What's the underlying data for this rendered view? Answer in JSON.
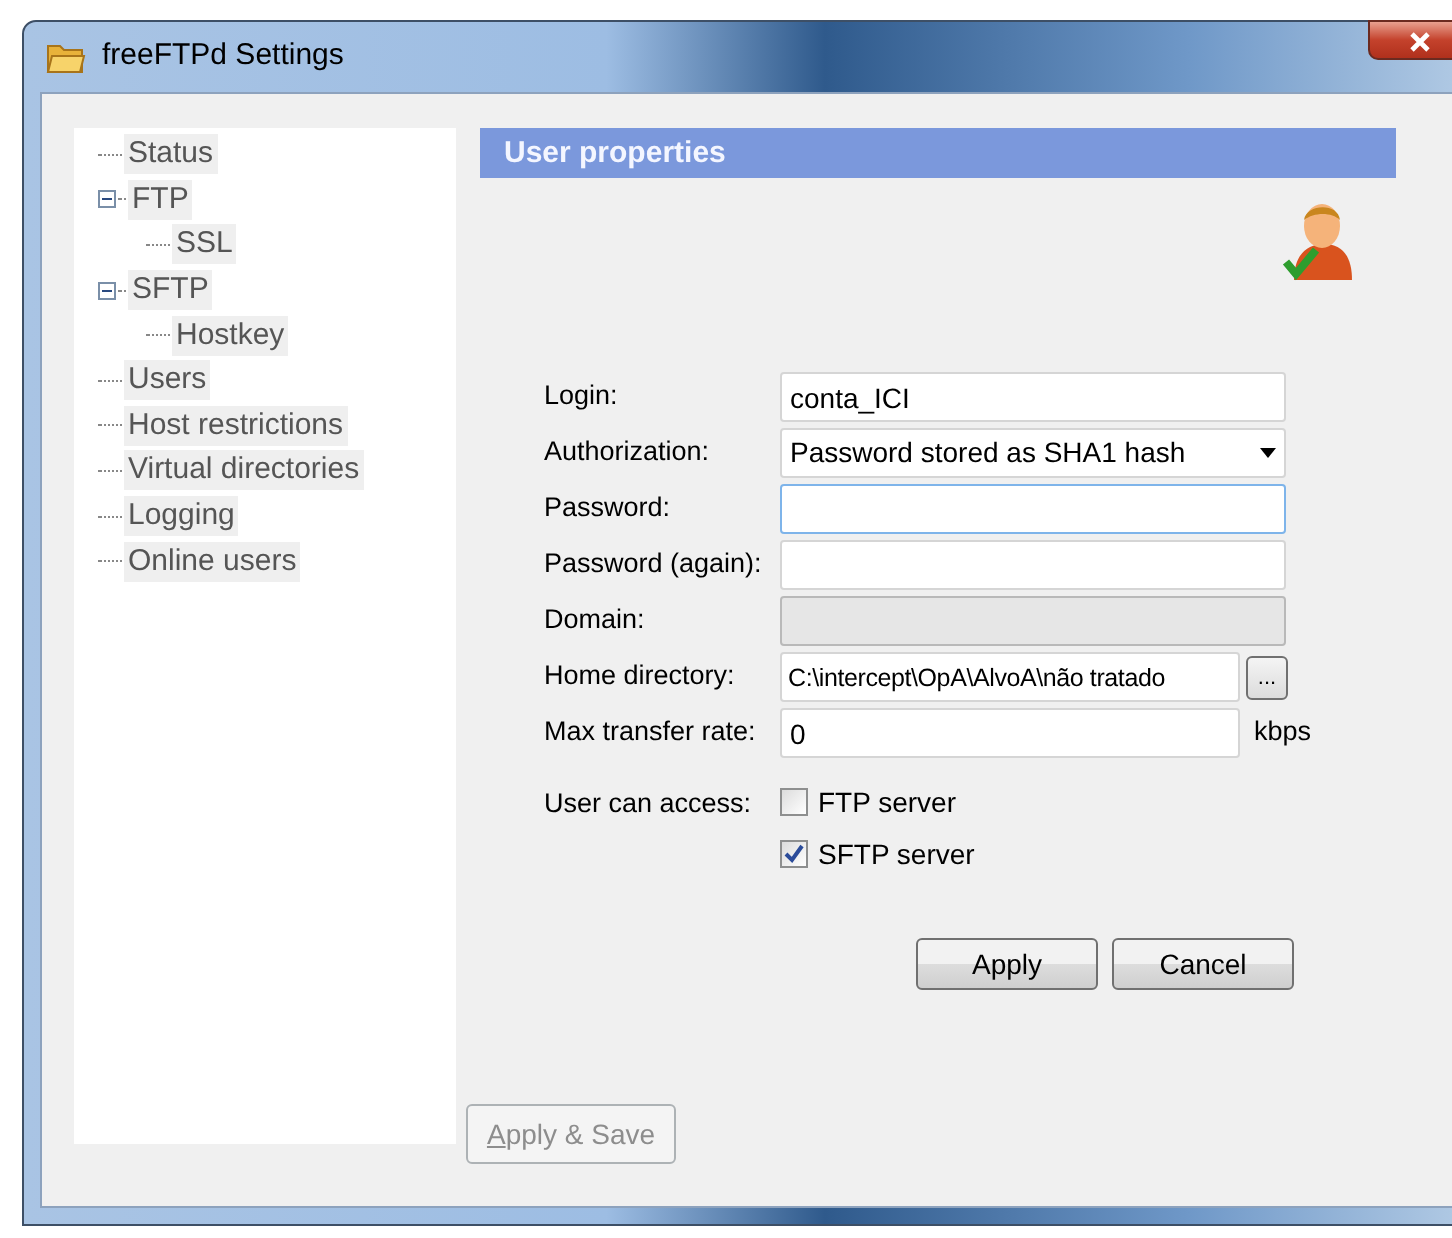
{
  "window": {
    "title": "freeFTPd Settings"
  },
  "tree": [
    {
      "label": "Status"
    },
    {
      "label": "FTP",
      "expanded": true,
      "children": [
        {
          "label": "SSL"
        }
      ]
    },
    {
      "label": "SFTP",
      "expanded": true,
      "children": [
        {
          "label": "Hostkey"
        }
      ]
    },
    {
      "label": "Users"
    },
    {
      "label": "Host restrictions"
    },
    {
      "label": "Virtual directories"
    },
    {
      "label": "Logging"
    },
    {
      "label": "Online users"
    }
  ],
  "panel": {
    "title": "User properties"
  },
  "fields": [
    {
      "kind": "text",
      "label": "Login:",
      "value": "conta_ICI",
      "disabled": false,
      "focused": false
    },
    {
      "kind": "select",
      "label": "Authorization:",
      "value": "Password stored as SHA1 hash"
    },
    {
      "kind": "text",
      "label": "Password:",
      "disabled": false,
      "focused": true
    },
    {
      "kind": "text",
      "label": "Password (again):",
      "disabled": false,
      "focused": false
    },
    {
      "kind": "text",
      "label": "Domain:",
      "disabled": true,
      "focused": false
    },
    {
      "kind": "browse",
      "label": "Home directory:",
      "value": "C:\\intercept\\OpA\\AlvoA\\não tratado",
      "button": "...",
      "disabled": false,
      "focused": false
    },
    {
      "kind": "unit",
      "label": "Max transfer rate:",
      "value": "0",
      "unit": "kbps",
      "disabled": false,
      "focused": false
    }
  ],
  "access": {
    "label": "User can access:",
    "options": [
      {
        "label": "FTP server",
        "checked": false
      },
      {
        "label": "SFTP server",
        "checked": true
      }
    ]
  },
  "buttons": [
    {
      "label": "Apply",
      "disabled": false
    },
    {
      "label": "Cancel",
      "disabled": false
    }
  ],
  "save_button": {
    "label": "Apply & Save",
    "disabled": true
  }
}
